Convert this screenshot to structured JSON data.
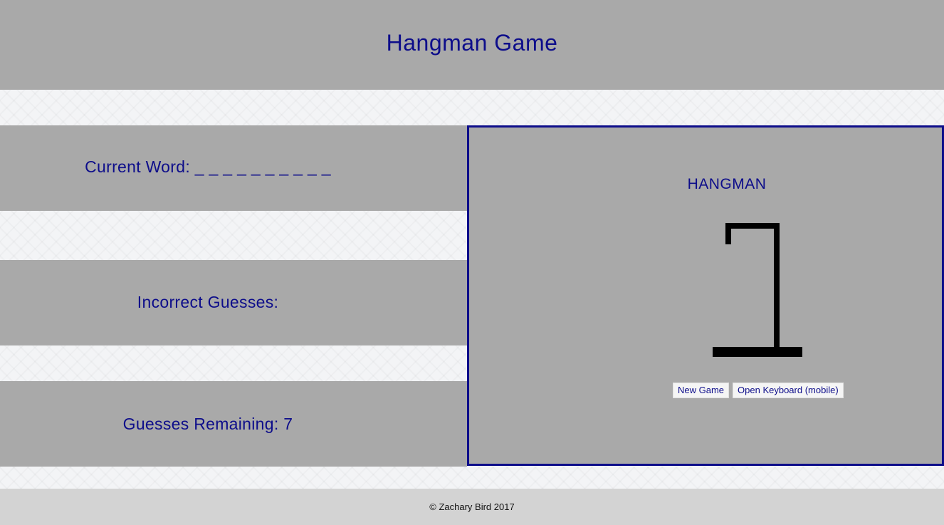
{
  "header": {
    "title": "Hangman Game"
  },
  "panels": {
    "current_word_label": "Current Word:",
    "current_word_value": "_ _ _ _ _ _ _ _ _ _",
    "incorrect_label": "Incorrect Guesses:",
    "incorrect_value": "",
    "remaining_label": "Guesses Remaining:",
    "remaining_value": "7"
  },
  "game": {
    "title": "HANGMAN",
    "new_game_label": "New Game",
    "keyboard_label": "Open Keyboard (mobile)"
  },
  "footer": {
    "text": "© Zachary Bird 2017"
  },
  "colors": {
    "accent": "#0d0d8a",
    "panel_bg": "#a9a9a9",
    "footer_bg": "#d3d3d3"
  }
}
